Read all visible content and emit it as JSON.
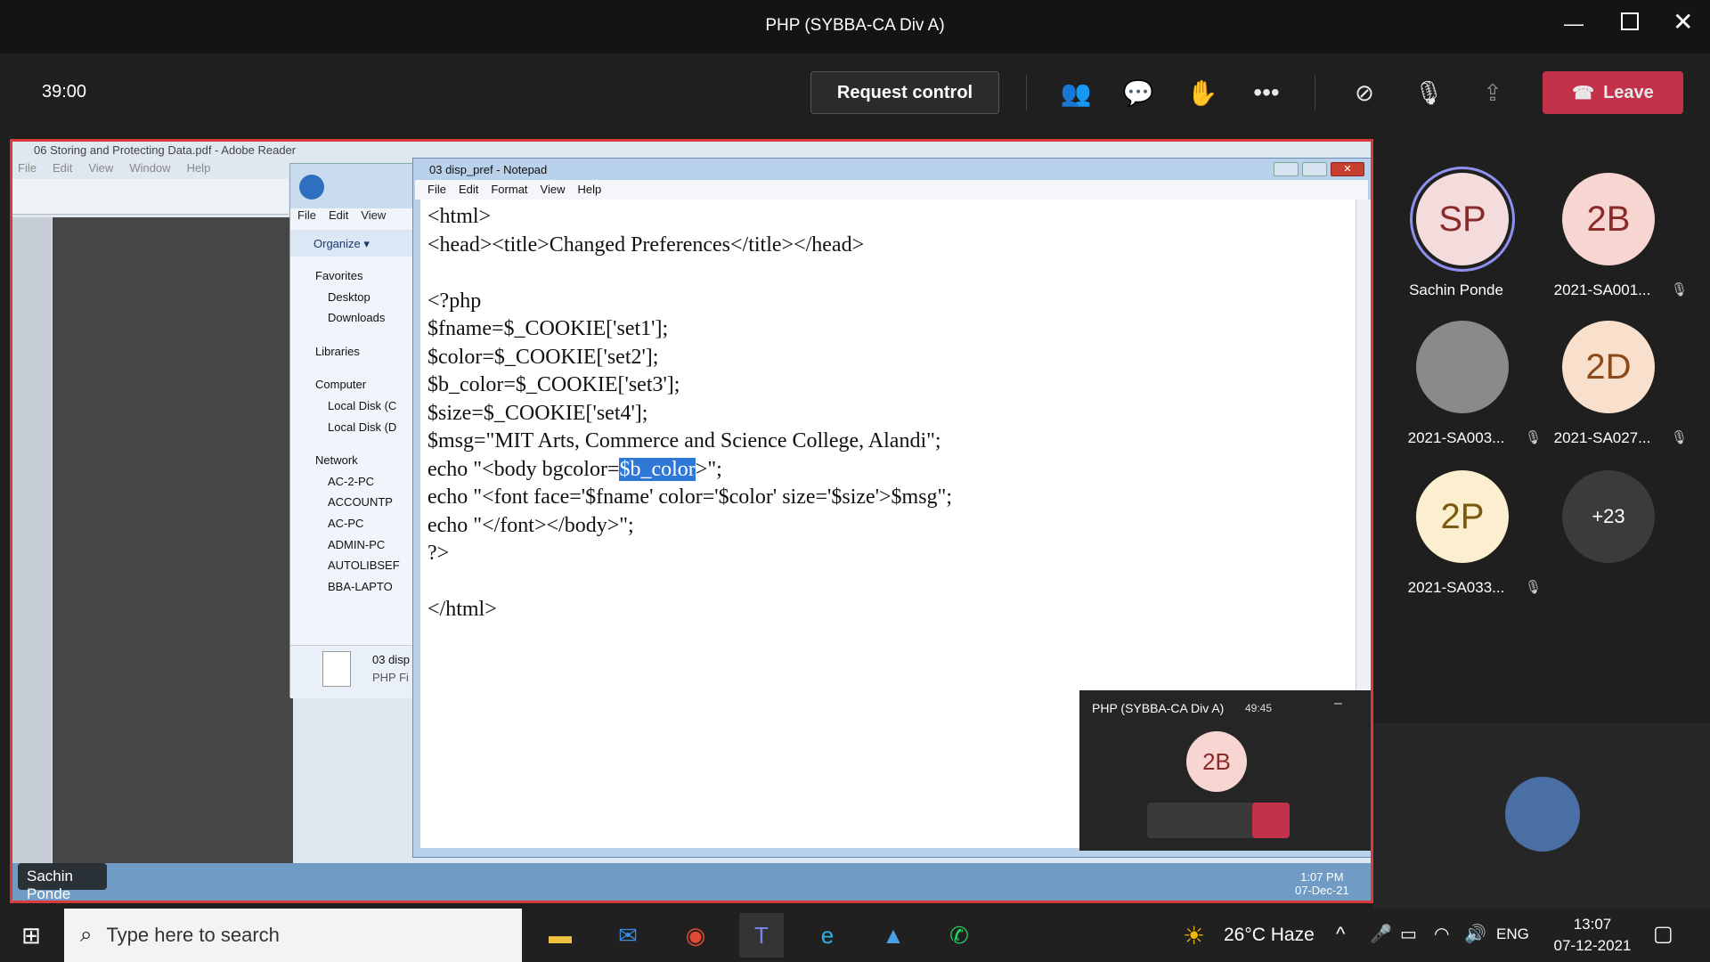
{
  "window": {
    "title": "PHP (SYBBA-CA Div A)"
  },
  "meeting": {
    "timer": "39:00",
    "request_control": "Request control",
    "leave": "Leave",
    "colors": {
      "leave": "#c4314b",
      "accent": "#6264a7"
    }
  },
  "share": {
    "reader_title": "06 Storing and Protecting Data.pdf - Adobe Reader",
    "reader_menu": [
      "File",
      "Edit",
      "View",
      "Window",
      "Help"
    ],
    "explorer": {
      "menu": [
        "File",
        "Edit",
        "View"
      ],
      "organize": "Organize ▾",
      "tree": [
        "Favorites",
        "Desktop",
        "Downloads",
        "Libraries",
        "Computer",
        "Local Disk (C",
        "Local Disk (D",
        "Network",
        "AC-2-PC",
        "ACCOUNTP",
        "AC-PC",
        "ADMIN-PC",
        "AUTOLIBSEF",
        "BBA-LAPTO"
      ],
      "file_name": "03 disp",
      "file_type": "PHP Fi"
    },
    "notepad": {
      "title": "03 disp_pref - Notepad",
      "menu": [
        "File",
        "Edit",
        "Format",
        "View",
        "Help"
      ],
      "lines": [
        "<html>",
        "<head><title>Changed Preferences</title></head>",
        "",
        "<?php",
        "$fname=$_COOKIE['set1'];",
        "$color=$_COOKIE['set2'];",
        "$b_color=$_COOKIE['set3'];",
        "$size=$_COOKIE['set4'];",
        "$msg=\"MIT Arts, Commerce and Science College, Alandi\";",
        "echo \"<body bgcolor=",
        "echo \"<font face='$fname' color='$color' size='$size'>$msg\";",
        "echo \"</font></body>\";",
        "?>",
        "",
        "</html>"
      ],
      "line9_selected": "$b_color",
      "line9_tail": ">\";"
    },
    "presenter_label": "Sachin Ponde",
    "win_clock": {
      "time": "1:07 PM",
      "date": "07-Dec-21"
    },
    "mini_window": {
      "title": "PHP (SYBBA-CA Div A)",
      "timer": "49:45",
      "avatar": "2B"
    }
  },
  "participants": [
    {
      "initials": "SP",
      "name": "Sachin Ponde",
      "bg": "#f5dcdc",
      "fg": "#8a2b2b",
      "muted": false,
      "ring": true
    },
    {
      "initials": "2B",
      "name": "2021-SA001...",
      "bg": "#f7d6d1",
      "fg": "#8a2b2b",
      "muted": true
    },
    {
      "initials": "",
      "name": "2021-SA003...",
      "bg": "#8a8a8a",
      "fg": "#fff",
      "muted": true,
      "photo": true
    },
    {
      "initials": "2D",
      "name": "2021-SA027...",
      "bg": "#f9e0cc",
      "fg": "#8a4a1a",
      "muted": true
    },
    {
      "initials": "2P",
      "name": "2021-SA033...",
      "bg": "#fbefcf",
      "fg": "#7a5a10",
      "muted": true
    },
    {
      "initials": "+23",
      "name": "",
      "bg": "#3b3b3b",
      "fg": "#fff",
      "muted": false
    }
  ],
  "taskbar": {
    "search_placeholder": "Type here to search",
    "weather": "26°C  Haze",
    "language": "ENG",
    "time": "13:07",
    "date": "07-12-2021"
  }
}
